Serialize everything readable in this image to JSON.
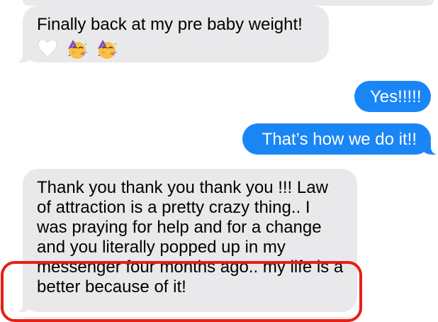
{
  "colors": {
    "received_bubble": "#e9e9eb",
    "sent_bubble": "#1a86f5",
    "highlight_outline": "#e81e14"
  },
  "messages": [
    {
      "direction": "received",
      "text": "Finally back at my pre baby weight!",
      "emoji": [
        "white-heart-icon",
        "partying-face-icon",
        "partying-face-icon"
      ]
    },
    {
      "direction": "sent",
      "text": "Yes!!!!!"
    },
    {
      "direction": "sent",
      "text": "That’s how we do it!!"
    },
    {
      "direction": "received",
      "text": "Thank you thank you thank you !!! Law of attraction is a pretty crazy thing.. I was praying for help and for a change and you literally popped up in my messenger four months ago.. my life is a better because of it!"
    }
  ]
}
